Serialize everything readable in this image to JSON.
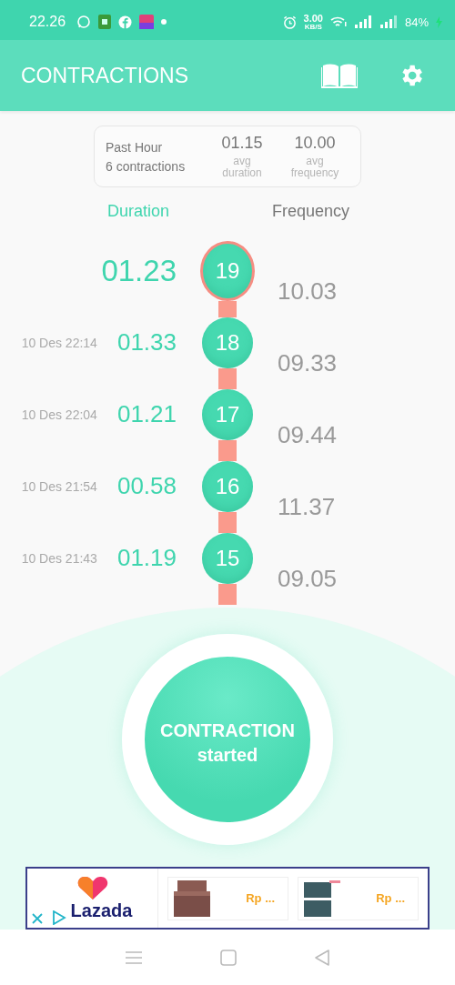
{
  "status_bar": {
    "time": "22.26",
    "speed": "3.00",
    "speed_unit": "KB/S",
    "battery": "84%"
  },
  "app_bar": {
    "title": "CONTRACTIONS"
  },
  "summary": {
    "period": "Past Hour",
    "count": "6 contractions",
    "avg_duration": "01.15",
    "avg_duration_label": "avg duration",
    "avg_frequency": "10.00",
    "avg_frequency_label": "avg frequency"
  },
  "columns": {
    "duration": "Duration",
    "frequency": "Frequency"
  },
  "rows": [
    {
      "date": "",
      "duration": "01.23",
      "number": "19",
      "current": true,
      "faded": false,
      "frequency": "10.03"
    },
    {
      "date": "10 Des 22:14",
      "duration": "01.33",
      "number": "18",
      "current": false,
      "faded": false,
      "frequency": "09.33"
    },
    {
      "date": "10 Des 22:04",
      "duration": "01.21",
      "number": "17",
      "current": false,
      "faded": false,
      "frequency": "09.44"
    },
    {
      "date": "10 Des 21:54",
      "duration": "00.58",
      "number": "16",
      "current": false,
      "faded": false,
      "frequency": "11.37"
    },
    {
      "date": "10 Des 21:43",
      "duration": "01.19",
      "number": "15",
      "current": false,
      "faded": false,
      "frequency": "09.05"
    }
  ],
  "action_button": {
    "line1": "CONTRACTION",
    "line2": "started"
  },
  "ad": {
    "brand": "Lazada",
    "products": [
      {
        "price": "Rp ..."
      },
      {
        "price": "Rp ..."
      }
    ]
  }
}
